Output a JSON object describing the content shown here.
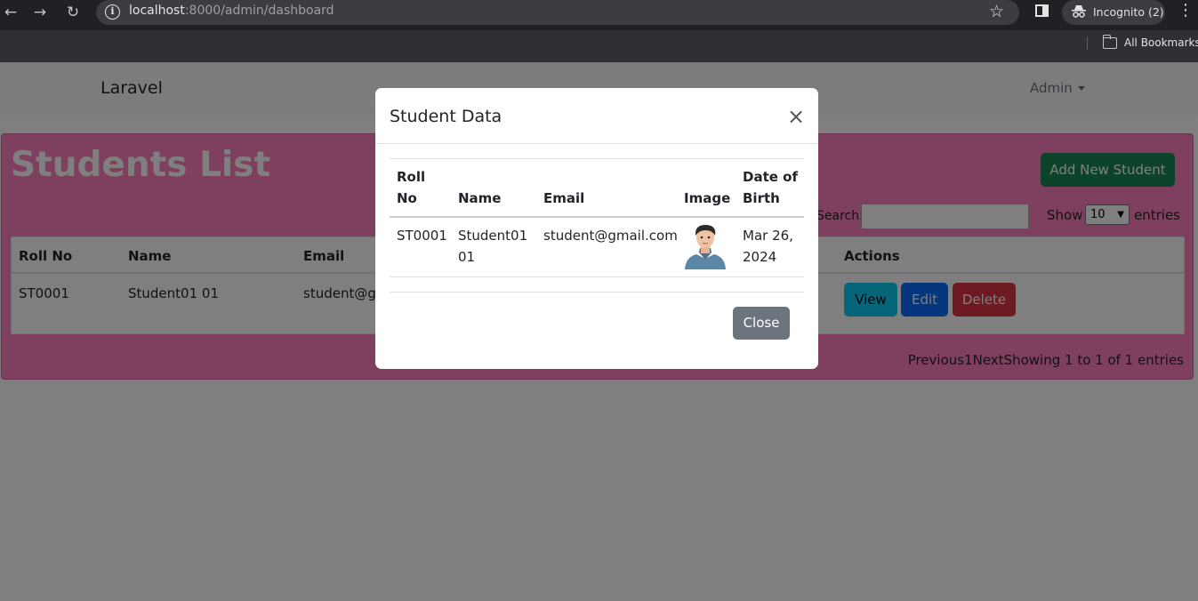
{
  "browser": {
    "url_host": "localhost",
    "url_path": ":8000/admin/dashboard",
    "incognito_label": "Incognito (2)",
    "bookmarks_label": "All Bookmarks",
    "icons": [
      "back-icon",
      "forward-icon",
      "reload-icon",
      "info-icon",
      "star-icon",
      "side-panel-icon",
      "incognito-icon",
      "menu-icon",
      "folder-icon"
    ]
  },
  "navbar": {
    "brand": "Laravel",
    "user_menu": "Admin"
  },
  "students_card": {
    "title": "Students List",
    "add_button": "Add New Student",
    "search_label": "Search:",
    "search_value": "",
    "show_label": "Show",
    "show_value": "10",
    "entries_label": "entries",
    "columns": [
      "Roll No",
      "Name",
      "Email",
      "Actions"
    ],
    "rows": [
      {
        "roll_no": "ST0001",
        "name": "Student01 01",
        "email_partial": "student@gr"
      }
    ],
    "actions": {
      "view": "View",
      "edit": "Edit",
      "delete": "Delete"
    },
    "pager_text": "Previous1NextShowing 1 to 1 of 1 entries",
    "colors": {
      "card_bg": "#ff7fbe",
      "add_btn": "#198754",
      "view_btn": "#0dcaf0",
      "edit_btn": "#0d6efd",
      "delete_btn": "#dc3545"
    }
  },
  "modal": {
    "title": "Student Data",
    "close_symbol": "×",
    "headers": {
      "roll_no_1": "Roll",
      "roll_no_2": "No",
      "name": "Name",
      "email": "Email",
      "image": "Image",
      "dob_1": "Date of",
      "dob_2": "Birth"
    },
    "row": {
      "roll_no": "ST0001",
      "name_1": "Student01",
      "name_2": "01",
      "email": "student@gmail.com",
      "image": "student-avatar",
      "dob_1": "Mar 26,",
      "dob_2": "2024"
    },
    "close_button": "Close"
  }
}
